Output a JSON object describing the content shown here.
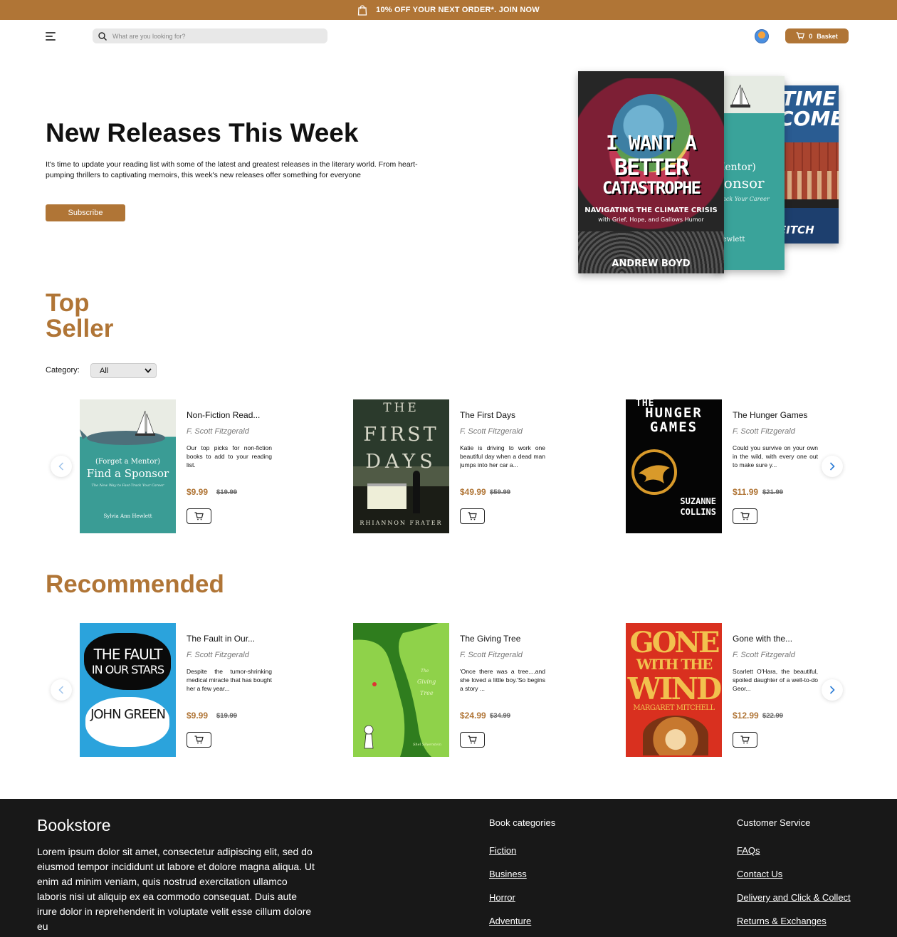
{
  "promo": {
    "text": "10% OFF YOUR NEXT ORDER*. JOIN NOW",
    "icon": "shopping-bag-icon"
  },
  "header": {
    "search_placeholder": "What are you looking for?",
    "basket_count": "0",
    "basket_label": "Basket"
  },
  "hero": {
    "title": "New Releases This Week",
    "description": "It's time to update your reading list with some of the latest and greatest releases in the literary world. From heart-pumping thrillers to captivating memoirs, this week's new releases offer something for everyone",
    "subscribe_label": "Subscribe",
    "covers": [
      {
        "title_1": "I WANT A",
        "title_2": "BETTER",
        "title_3": "CATASTROPHE",
        "subtitle": "NAVIGATING THE CLIMATE CRISIS",
        "subtitle2": "with Grief, Hope, and Gallows Humor",
        "author": "ANDREW BOYD"
      },
      {
        "line1": "Mentor)",
        "line2": "ponsor",
        "line3": "Track Your Career",
        "author": "Hewlett"
      },
      {
        "line1": "TIME",
        "line2": "COME",
        "line3": "EITCH"
      }
    ]
  },
  "top_seller": {
    "title_line1": "Top",
    "title_line2": "Seller",
    "category_label": "Category:",
    "category_value": "All",
    "books": [
      {
        "title": "Non-Fiction Read...",
        "author": "F. Scott Fitzgerald",
        "desc": "Our top picks for non-fiction books to add to your reading list.",
        "price": "$9.99",
        "old_price": "$19.99",
        "cover": {
          "line1": "(Forget a Mentor)",
          "line2": "Find a Sponsor",
          "line3": "The New Way to Fast-Track Your Career",
          "author": "Sylvia Ann Hewlett"
        }
      },
      {
        "title": "The First Days",
        "author": "F. Scott Fitzgerald",
        "desc": "Katie is driving to work one beautiful day when a dead man jumps into her car a...",
        "price": "$49.99",
        "old_price": "$59.99",
        "cover": {
          "line1": "THE",
          "line2": "FIRST",
          "line3": "DAYS",
          "author": "RHIANNON FRATER"
        }
      },
      {
        "title": "The Hunger Games",
        "author": "F. Scott Fitzgerald",
        "desc": "Could you survive on your own in the wild, with every one out to make sure y...",
        "price": "$11.99",
        "old_price": "$21.99",
        "cover": {
          "line1": "THE",
          "line2": "HUNGER",
          "line3": "GAMES",
          "author1": "SUZANNE",
          "author2": "COLLINS"
        }
      }
    ]
  },
  "recommended": {
    "title": "Recommended",
    "books": [
      {
        "title": "The Fault in Our...",
        "author": "F. Scott Fitzgerald",
        "desc": "Despite the tumor-shrinking medical miracle that has bought her a few year...",
        "price": "$9.99",
        "old_price": "$19.99",
        "cover": {
          "line1": "THE FAULT",
          "line2": "IN OUR STARS",
          "author": "JOHN GREEN"
        }
      },
      {
        "title": "The Giving Tree",
        "author": "F. Scott Fitzgerald",
        "desc": "'Once there was a tree....and she loved a little boy.'So begins a story ...",
        "price": "$24.99",
        "old_price": "$34.99",
        "cover": {
          "line1": "The",
          "line2": "Giving",
          "line3": "Tree",
          "author": "Shel Silverstein"
        }
      },
      {
        "title": "Gone with the...",
        "author": "F. Scott Fitzgerald",
        "desc": "Scarlett O'Hara, the beautiful, spoiled daughter of a well-to-do Geor...",
        "price": "$12.99",
        "old_price": "$22.99",
        "cover": {
          "line1": "GONE",
          "line2": "WITH THE",
          "line3": "WIND",
          "author": "MARGARET MITCHELL"
        }
      }
    ]
  },
  "footer": {
    "brand": "Bookstore",
    "lorem": "Lorem ipsum dolor sit amet, consectetur adipiscing elit, sed do eiusmod tempor incididunt ut labore et dolore magna aliqua. Ut enim ad minim veniam, quis nostrud exercitation ullamco laboris nisi ut aliquip ex ea commodo consequat. Duis aute irure dolor in reprehenderit in voluptate velit esse cillum dolore eu",
    "categories_heading": "Book categories",
    "categories": [
      "Fiction",
      "Business",
      "Horror",
      "Adventure"
    ],
    "service_heading": "Customer Service",
    "service_links": [
      "FAQs",
      "Contact Us",
      "Delivery and Click & Collect",
      "Returns & Exchanges"
    ]
  },
  "colors": {
    "accent": "#b07536",
    "footer_bg": "#181818",
    "arrow_blue": "#2a7bd5"
  }
}
